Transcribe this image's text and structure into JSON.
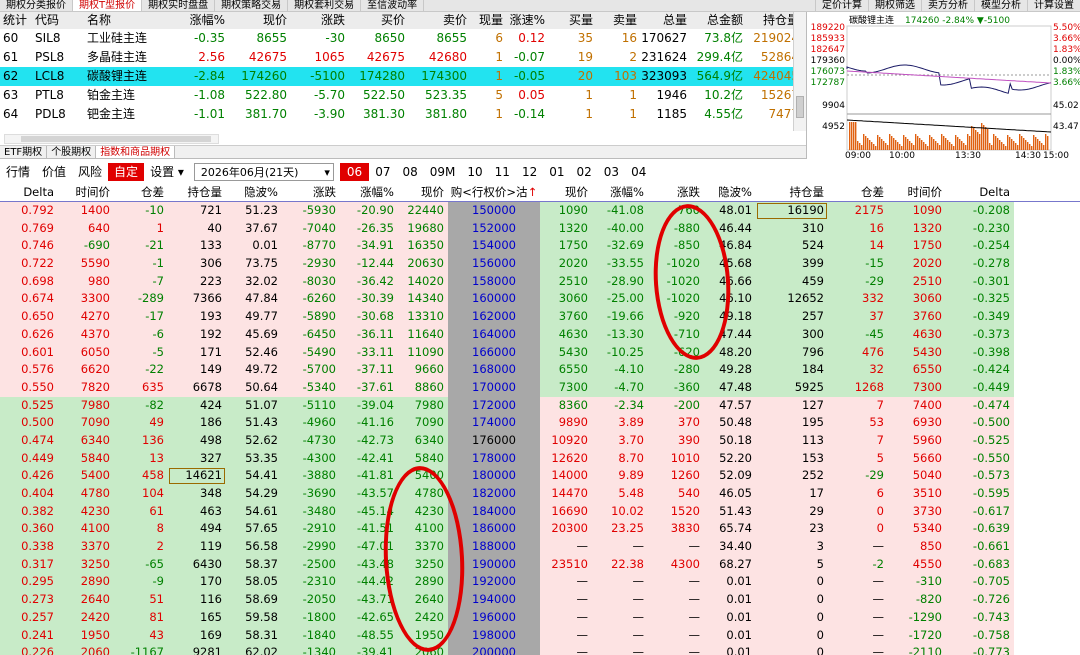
{
  "top_tabs": [
    "期权分类报价",
    "期权T型报价",
    "期权实时盘盘",
    "期权策略交易",
    "期权套利交易",
    "至信波动率"
  ],
  "top_tabs_active": 1,
  "top_right_tabs": [
    "定价计算",
    "期权筛选",
    "卖方分析",
    "模型分析",
    "计算设置"
  ],
  "futures_header": [
    "统计",
    "代码",
    "名称",
    "涨幅%",
    "现价",
    "涨跌",
    "买价",
    "卖价",
    "现量",
    "涨速%",
    "买量",
    "卖量",
    "总量",
    "总金额",
    "持仓量"
  ],
  "futures_rows": [
    [
      "60",
      "SIL8",
      "工业硅主连",
      "-0.35",
      "8655",
      "-30",
      "8650",
      "8655",
      "6",
      "0.12",
      "35",
      "16",
      "170627",
      "73.8亿",
      "219024"
    ],
    [
      "61",
      "PSL8",
      "多晶硅主连",
      "2.56",
      "42675",
      "1065",
      "42675",
      "42680",
      "1",
      "-0.07",
      "19",
      "2",
      "231624",
      "299.4亿",
      "52864"
    ],
    [
      "62",
      "LCL8",
      "碳酸锂主连",
      "-2.84",
      "174260",
      "-5100",
      "174280",
      "174300",
      "1",
      "-0.05",
      "20",
      "103",
      "323093",
      "564.9亿",
      "424045"
    ],
    [
      "63",
      "PTL8",
      "铂金主连",
      "-1.08",
      "522.80",
      "-5.70",
      "522.50",
      "523.35",
      "5",
      "0.05",
      "1",
      "1",
      "1946",
      "10.2亿",
      "15267"
    ],
    [
      "64",
      "PDL8",
      "钯金主连",
      "-1.01",
      "381.70",
      "-3.90",
      "381.30",
      "381.80",
      "1",
      "-0.14",
      "1",
      "1",
      "1185",
      "4.55亿",
      "7477"
    ]
  ],
  "mini_chart": {
    "title": "碳酸锂主连",
    "price": "174260",
    "pct": "-2.84%",
    "chg": "▼-5100",
    "left_ticks": [
      "189220",
      "185933",
      "182647",
      "179360",
      "176073",
      "172787"
    ],
    "right_ticks": [
      "5.50%",
      "3.66%",
      "1.83%",
      "0.00%",
      "1.83%",
      "3.66%"
    ],
    "vol_ticks_left": [
      "9904",
      "4952"
    ],
    "vol_ticks_right": [
      "45.02",
      "43.47"
    ],
    "x_ticks": [
      "09:00",
      "10:00",
      "13:30",
      "14:30",
      "15:00"
    ]
  },
  "sub_tabs": [
    "ETF期权",
    "个股期权",
    "指数和商品期权"
  ],
  "sub_tabs_active": 2,
  "toolbar": {
    "items": [
      "行情",
      "价值",
      "风险"
    ],
    "custom": "自定",
    "settings": "设置",
    "contract": "2026年06月(21天)",
    "months": [
      "06",
      "07",
      "08",
      "09M",
      "10",
      "11",
      "12",
      "01",
      "02",
      "03",
      "04"
    ],
    "active_month": "06"
  },
  "option_header": [
    "Delta",
    "时间价",
    "仓差",
    "持仓量",
    "隐波%",
    "涨跌",
    "涨幅%",
    "现价",
    "购<行权价>沽",
    "现价",
    "涨幅%",
    "涨跌",
    "隐波%",
    "持仓量",
    "仓差",
    "时间价",
    "Delta"
  ],
  "option_rows": [
    [
      "0.792",
      "1400",
      "-10",
      "721",
      "51.23",
      "-5930",
      "-20.90",
      "22440",
      "150000",
      "1090",
      "-41.08",
      "-760",
      "48.01",
      "16190",
      "2175",
      "1090",
      "-0.208"
    ],
    [
      "0.769",
      "640",
      "1",
      "40",
      "37.67",
      "-7040",
      "-26.35",
      "19680",
      "152000",
      "1320",
      "-40.00",
      "-880",
      "46.44",
      "310",
      "16",
      "1320",
      "-0.230"
    ],
    [
      "0.746",
      "-690",
      "-21",
      "133",
      "0.01",
      "-8770",
      "-34.91",
      "16350",
      "154000",
      "1750",
      "-32.69",
      "-850",
      "46.84",
      "524",
      "14",
      "1750",
      "-0.254"
    ],
    [
      "0.722",
      "5590",
      "-1",
      "306",
      "73.75",
      "-2930",
      "-12.44",
      "20630",
      "156000",
      "2020",
      "-33.55",
      "-1020",
      "45.68",
      "399",
      "-15",
      "2020",
      "-0.278"
    ],
    [
      "0.698",
      "980",
      "-7",
      "223",
      "32.02",
      "-8030",
      "-36.42",
      "14020",
      "158000",
      "2510",
      "-28.90",
      "-1020",
      "46.66",
      "459",
      "-29",
      "2510",
      "-0.301"
    ],
    [
      "0.674",
      "3300",
      "-289",
      "7366",
      "47.84",
      "-6260",
      "-30.39",
      "14340",
      "160000",
      "3060",
      "-25.00",
      "-1020",
      "46.10",
      "12652",
      "332",
      "3060",
      "-0.325"
    ],
    [
      "0.650",
      "4270",
      "-17",
      "193",
      "49.77",
      "-5890",
      "-30.68",
      "13310",
      "162000",
      "3760",
      "-19.66",
      "-920",
      "49.18",
      "257",
      "37",
      "3760",
      "-0.349"
    ],
    [
      "0.626",
      "4370",
      "-6",
      "192",
      "45.69",
      "-6450",
      "-36.11",
      "11640",
      "164000",
      "4630",
      "-13.30",
      "-710",
      "47.44",
      "300",
      "-45",
      "4630",
      "-0.373"
    ],
    [
      "0.601",
      "6050",
      "-5",
      "171",
      "52.46",
      "-5490",
      "-33.11",
      "11090",
      "166000",
      "5430",
      "-10.25",
      "-620",
      "48.20",
      "796",
      "476",
      "5430",
      "-0.398"
    ],
    [
      "0.576",
      "6620",
      "-22",
      "149",
      "49.72",
      "-5700",
      "-37.11",
      "9660",
      "168000",
      "6550",
      "-4.10",
      "-280",
      "49.28",
      "184",
      "32",
      "6550",
      "-0.424"
    ],
    [
      "0.550",
      "7820",
      "635",
      "6678",
      "50.64",
      "-5340",
      "-37.61",
      "8860",
      "170000",
      "7300",
      "-4.70",
      "-360",
      "47.48",
      "5925",
      "1268",
      "7300",
      "-0.449"
    ],
    [
      "0.525",
      "7980",
      "-82",
      "424",
      "51.07",
      "-5110",
      "-39.04",
      "7980",
      "172000",
      "8360",
      "-2.34",
      "-200",
      "47.57",
      "127",
      "7",
      "7400",
      "-0.474"
    ],
    [
      "0.500",
      "7090",
      "49",
      "186",
      "51.43",
      "-4960",
      "-41.16",
      "7090",
      "174000",
      "9890",
      "3.89",
      "370",
      "50.48",
      "195",
      "53",
      "6930",
      "-0.500"
    ],
    [
      "0.474",
      "6340",
      "136",
      "498",
      "52.62",
      "-4730",
      "-42.73",
      "6340",
      "176000",
      "10920",
      "3.70",
      "390",
      "50.18",
      "113",
      "7",
      "5960",
      "-0.525"
    ],
    [
      "0.449",
      "5840",
      "13",
      "327",
      "53.35",
      "-4300",
      "-42.41",
      "5840",
      "178000",
      "12620",
      "8.70",
      "1010",
      "52.20",
      "153",
      "5",
      "5660",
      "-0.550"
    ],
    [
      "0.426",
      "5400",
      "458",
      "14621",
      "54.41",
      "-3880",
      "-41.81",
      "5400",
      "180000",
      "14000",
      "9.89",
      "1260",
      "52.09",
      "252",
      "-29",
      "5040",
      "-0.573"
    ],
    [
      "0.404",
      "4780",
      "104",
      "348",
      "54.29",
      "-3690",
      "-43.57",
      "4780",
      "182000",
      "14470",
      "5.48",
      "540",
      "46.05",
      "17",
      "6",
      "3510",
      "-0.595"
    ],
    [
      "0.382",
      "4230",
      "61",
      "463",
      "54.61",
      "-3480",
      "-45.14",
      "4230",
      "184000",
      "16690",
      "10.02",
      "1520",
      "51.43",
      "29",
      "0",
      "3730",
      "-0.617"
    ],
    [
      "0.360",
      "4100",
      "8",
      "494",
      "57.65",
      "-2910",
      "-41.51",
      "4100",
      "186000",
      "20300",
      "23.25",
      "3830",
      "65.74",
      "23",
      "0",
      "5340",
      "-0.639"
    ],
    [
      "0.338",
      "3370",
      "2",
      "119",
      "56.58",
      "-2990",
      "-47.01",
      "3370",
      "188000",
      "—",
      "—",
      "—",
      "34.40",
      "3",
      "—",
      "850",
      "-0.661"
    ],
    [
      "0.317",
      "3250",
      "-65",
      "6430",
      "58.37",
      "-2500",
      "-43.48",
      "3250",
      "190000",
      "23510",
      "22.38",
      "4300",
      "68.27",
      "5",
      "-2",
      "4550",
      "-0.683"
    ],
    [
      "0.295",
      "2890",
      "-9",
      "170",
      "58.05",
      "-2310",
      "-44.42",
      "2890",
      "192000",
      "—",
      "—",
      "—",
      "0.01",
      "0",
      "—",
      "-310",
      "-0.705"
    ],
    [
      "0.273",
      "2640",
      "51",
      "116",
      "58.69",
      "-2050",
      "-43.71",
      "2640",
      "194000",
      "—",
      "—",
      "—",
      "0.01",
      "0",
      "—",
      "-820",
      "-0.726"
    ],
    [
      "0.257",
      "2420",
      "81",
      "165",
      "59.58",
      "-1800",
      "-42.65",
      "2420",
      "196000",
      "—",
      "—",
      "—",
      "0.01",
      "0",
      "—",
      "-1290",
      "-0.743"
    ],
    [
      "0.241",
      "1950",
      "43",
      "169",
      "58.31",
      "-1840",
      "-48.55",
      "1950",
      "198000",
      "—",
      "—",
      "—",
      "0.01",
      "0",
      "—",
      "-1720",
      "-0.758"
    ],
    [
      "0.226",
      "2060",
      "-1167",
      "9281",
      "62.02",
      "-1340",
      "-39.41",
      "2060",
      "200000",
      "—",
      "—",
      "—",
      "0.01",
      "0",
      "—",
      "-2110",
      "-0.773"
    ]
  ],
  "atm_strike": "176000",
  "colors": {
    "up": "#e00000",
    "down": "#008000",
    "pink": "#fde3e3",
    "green": "#c8ebc8",
    "strike": "#a8a8a8",
    "select": "#22e3f0"
  }
}
